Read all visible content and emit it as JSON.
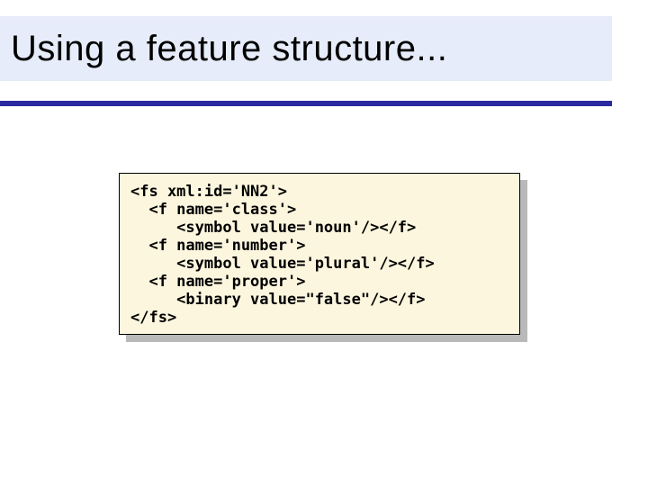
{
  "title": "Using a feature structure...",
  "code": {
    "l1": "<fs xml:id='NN2'>",
    "l2": "  <f name='class'>",
    "l3": "     <symbol value='noun'/></f>",
    "l4": "  <f name='number'>",
    "l5": "     <symbol value='plural'/></f>",
    "l6": "  <f name='proper'>",
    "l7": "     <binary value=\"false\"/></f>",
    "l8": "</fs>"
  }
}
